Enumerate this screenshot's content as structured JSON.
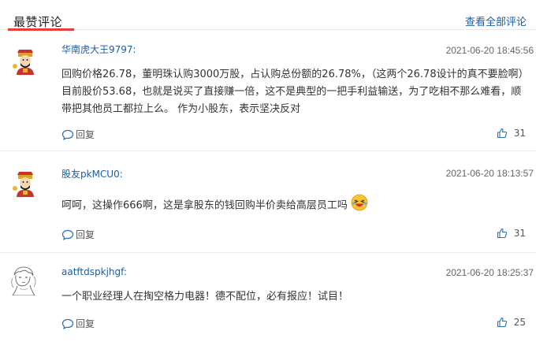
{
  "header": {
    "title": "最赞评论",
    "view_all": "查看全部评论"
  },
  "comments": [
    {
      "username": "华南虎大王9797:",
      "time": "2021-06-20 18:45:56",
      "content": "回购价格26.78，董明珠认购3000万股，占认购总份额的26.78%，（这两个26.78设计的真不要脸啊） 目前股价53.68，也就是说买了直接赚一倍，这不是典型的一把手利益输送，为了吃相不那么难看，顺带把其他员工都拉上么。 作为小股东，表示坚决反对",
      "reply_label": "回复",
      "likes": "31"
    },
    {
      "username": "股友pkMCU0:",
      "time": "2021-06-20 18:13:57",
      "content": "呵呵，这操作666啊，这是拿股东的钱回购半价卖给高层员工吗",
      "reply_label": "回复",
      "likes": "31"
    },
    {
      "username": "aatftdspkjhgf:",
      "time": "2021-06-20 18:25:37",
      "content": "一个职业经理人在掏空格力电器！德不配位，必有报应！试目！",
      "reply_label": "回复",
      "likes": "25"
    }
  ],
  "icons": {
    "reply": "speech-bubble-icon",
    "like": "thumbs-up-icon",
    "emoji": "laughing-emoji-icon",
    "avatar_1": "god-of-wealth-avatar",
    "avatar_2": "god-of-wealth-avatar",
    "avatar_3": "sketch-character-avatar"
  },
  "colors": {
    "accent_red": "#e33d3d",
    "link_blue": "#1a5ea8",
    "icon_blue": "#2a6fb8"
  }
}
